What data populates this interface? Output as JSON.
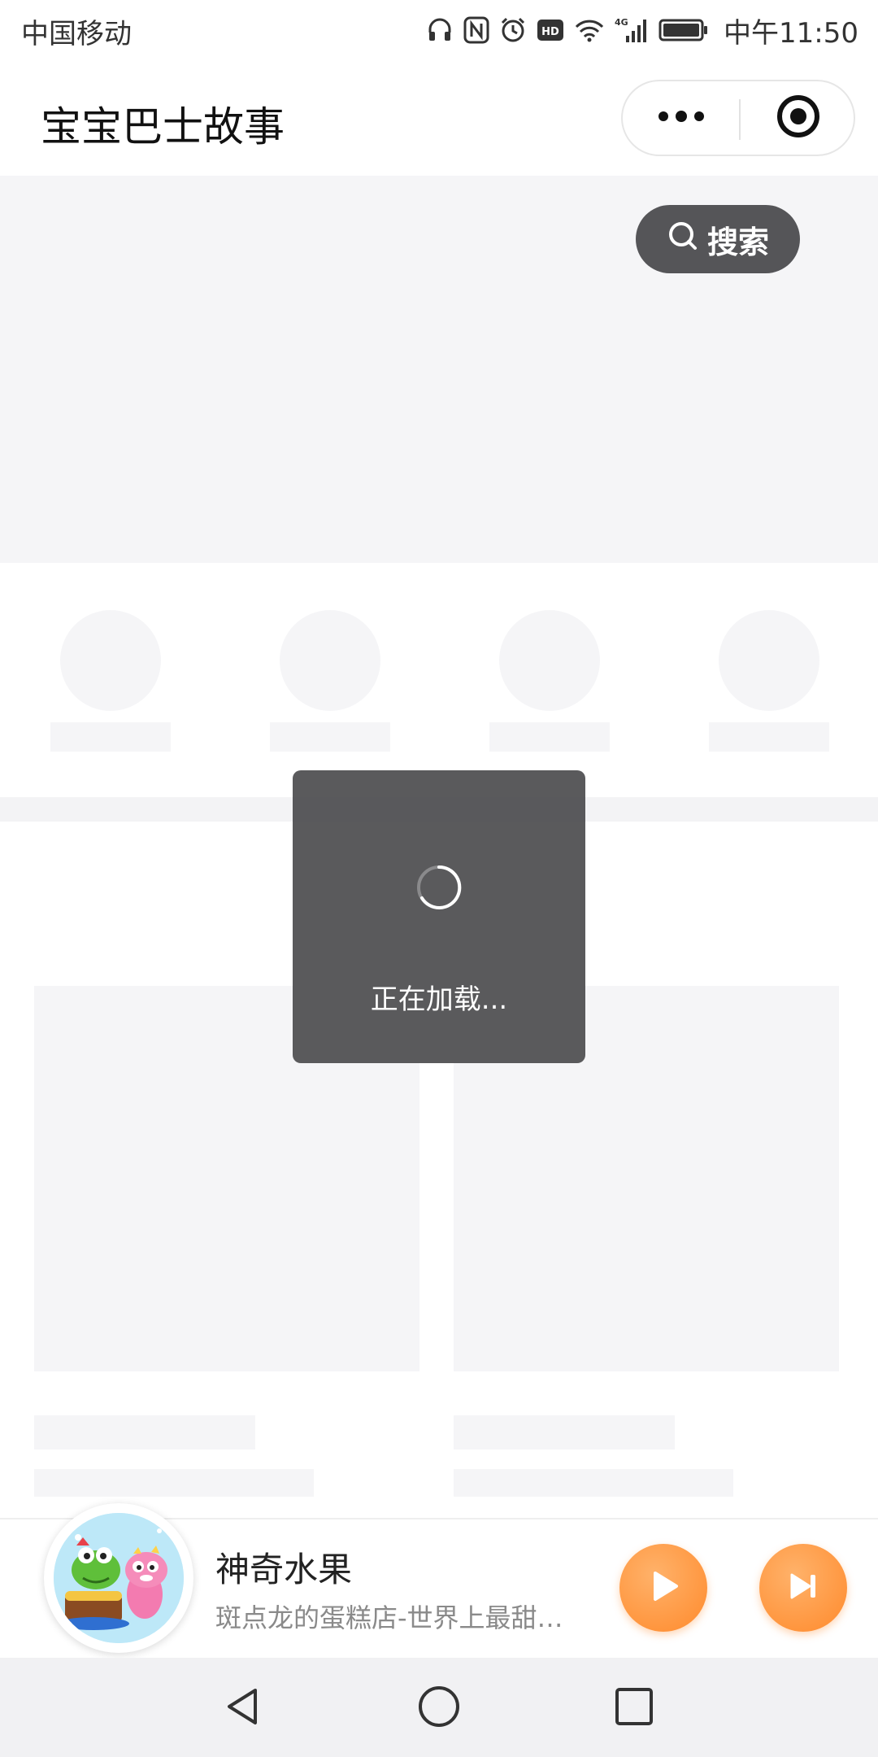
{
  "status_bar": {
    "carrier": "中国移动",
    "time": "中午11:50",
    "network": "4G",
    "icons": [
      "headset-icon",
      "nfc-icon",
      "alarm-icon",
      "hd-icon",
      "wifi-icon",
      "signal-icon",
      "battery-icon"
    ]
  },
  "header": {
    "title": "宝宝巴士故事",
    "more_icon": "more-dots-icon",
    "close_icon": "target-icon"
  },
  "search": {
    "label": "搜索"
  },
  "loading": {
    "text": "正在加载..."
  },
  "player": {
    "title": "神奇水果",
    "subtitle": "斑点龙的蛋糕店-世界上最甜…",
    "accent": "#ff8a2c"
  },
  "colors": {
    "skeleton": "#f5f5f7",
    "toast_bg": "#4c4c4e",
    "search_bg": "#555558"
  }
}
